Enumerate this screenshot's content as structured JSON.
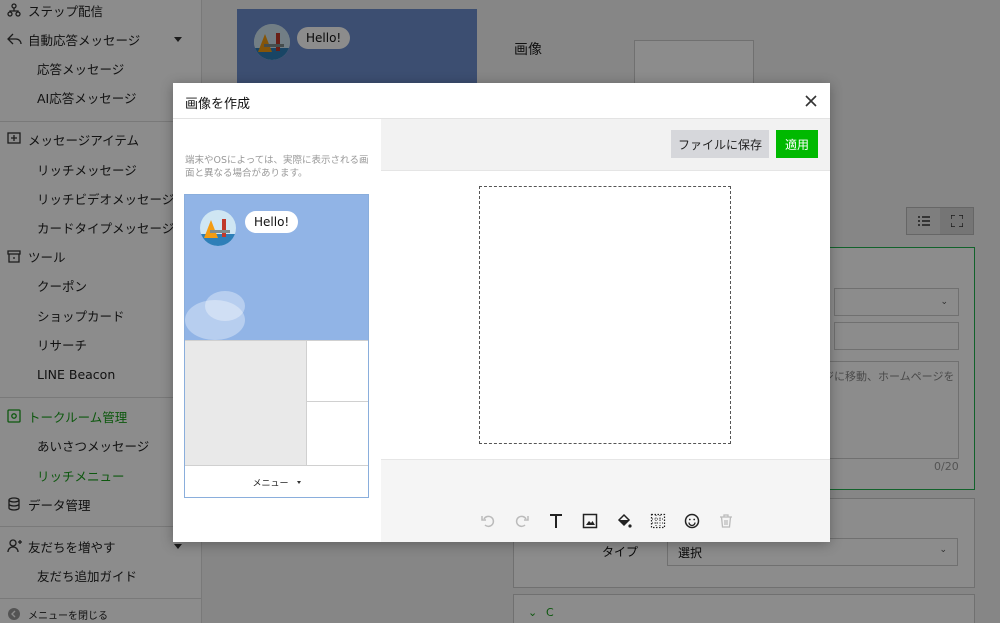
{
  "sidebar": {
    "items": [
      {
        "label": "ステップ配信",
        "icon": "step-icon"
      },
      {
        "label": "自動応答メッセージ",
        "icon": "auto-reply-icon"
      },
      {
        "label": "応答メッセージ"
      },
      {
        "label": "AI応答メッセージ"
      },
      {
        "label": "メッセージアイテム",
        "icon": "message-item-icon"
      },
      {
        "label": "リッチメッセージ"
      },
      {
        "label": "リッチビデオメッセージ"
      },
      {
        "label": "カードタイプメッセージ"
      },
      {
        "label": "ツール",
        "icon": "tool-icon"
      },
      {
        "label": "クーポン"
      },
      {
        "label": "ショップカード"
      },
      {
        "label": "リサーチ"
      },
      {
        "label": "LINE Beacon"
      },
      {
        "label": "トークルーム管理",
        "icon": "talk-room-icon"
      },
      {
        "label": "あいさつメッセージ"
      },
      {
        "label": "リッチメニュー"
      },
      {
        "label": "データ管理",
        "icon": "database-icon"
      },
      {
        "label": "友だちを増やす",
        "icon": "add-friend-icon"
      },
      {
        "label": "友だち追加ガイド"
      }
    ],
    "close_menu_label": "メニューを閉じる"
  },
  "background": {
    "bubble_text": "Hello!",
    "image_label": "画像",
    "textarea_snippet": "ジに移動、ホームページを",
    "char_count": "0/20",
    "type_label": "タイプ",
    "type_value": "選択",
    "section_label": "C"
  },
  "modal": {
    "title": "画像を作成",
    "note": "端末やOSによっては、実際に表示される画面と異なる場合があります。",
    "preview_bubble": "Hello!",
    "menu_label": "メニュー",
    "save_label": "ファイルに保存",
    "apply_label": "適用",
    "tools": [
      "undo-icon",
      "redo-icon",
      "text-icon",
      "image-icon",
      "fill-icon",
      "grid-icon",
      "emoji-icon",
      "trash-icon"
    ]
  },
  "colors": {
    "accent": "#00b900",
    "active_nav": "#19a01b",
    "preview_sky": "#91b4e6"
  }
}
